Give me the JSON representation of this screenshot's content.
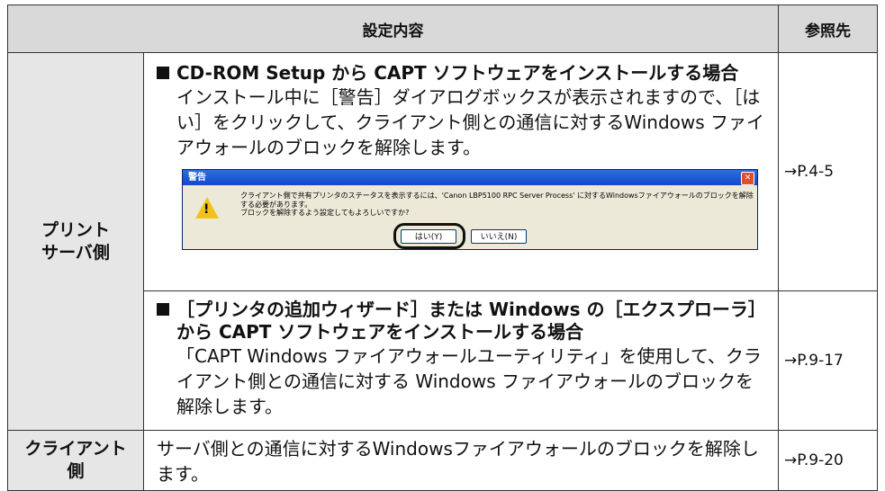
{
  "header": {
    "content_title": "設定内容",
    "ref_title": "参照先"
  },
  "rows": {
    "server_label": "プリント\nサーバ側",
    "client_label": "クライアント\n側",
    "section1": {
      "heading": "CD-ROM Setup から CAPT ソフトウェアをインストールする場合",
      "body": "インストール中に［警告］ダイアログボックスが表示されますので、［はい］をクリックして、クライアント側との通信に対するWindows ファイアウォールのブロックを解除します。",
      "ref": "→P.4-5"
    },
    "section2": {
      "heading": "［プリンタの追加ウィザード］または Windows の［エクスプローラ］から CAPT ソフトウェアをインストールする場合",
      "body": "「CAPT Windows ファイアウォールユーティリティ」を使用して、クライアント側との通信に対する Windows ファイアウォールのブロックを解除します。",
      "ref": "→P.9-17"
    },
    "section3": {
      "body": "サーバ側との通信に対するWindowsファイアウォールのブロックを解除します。",
      "ref": "→P.9-20"
    }
  },
  "dialog": {
    "title": "警告",
    "message": "クライアント側で共有プリンタのステータスを表示するには、'Canon LBP5100 RPC Server Process' に対するWindowsファイアウォールのブロックを解除する必要があります。\nブロックを解除するよう設定してもよろしいですか?",
    "yes_label": "はい(Y)",
    "no_label": "いいえ(N)",
    "close_glyph": "✕",
    "warning_glyph": "!"
  }
}
